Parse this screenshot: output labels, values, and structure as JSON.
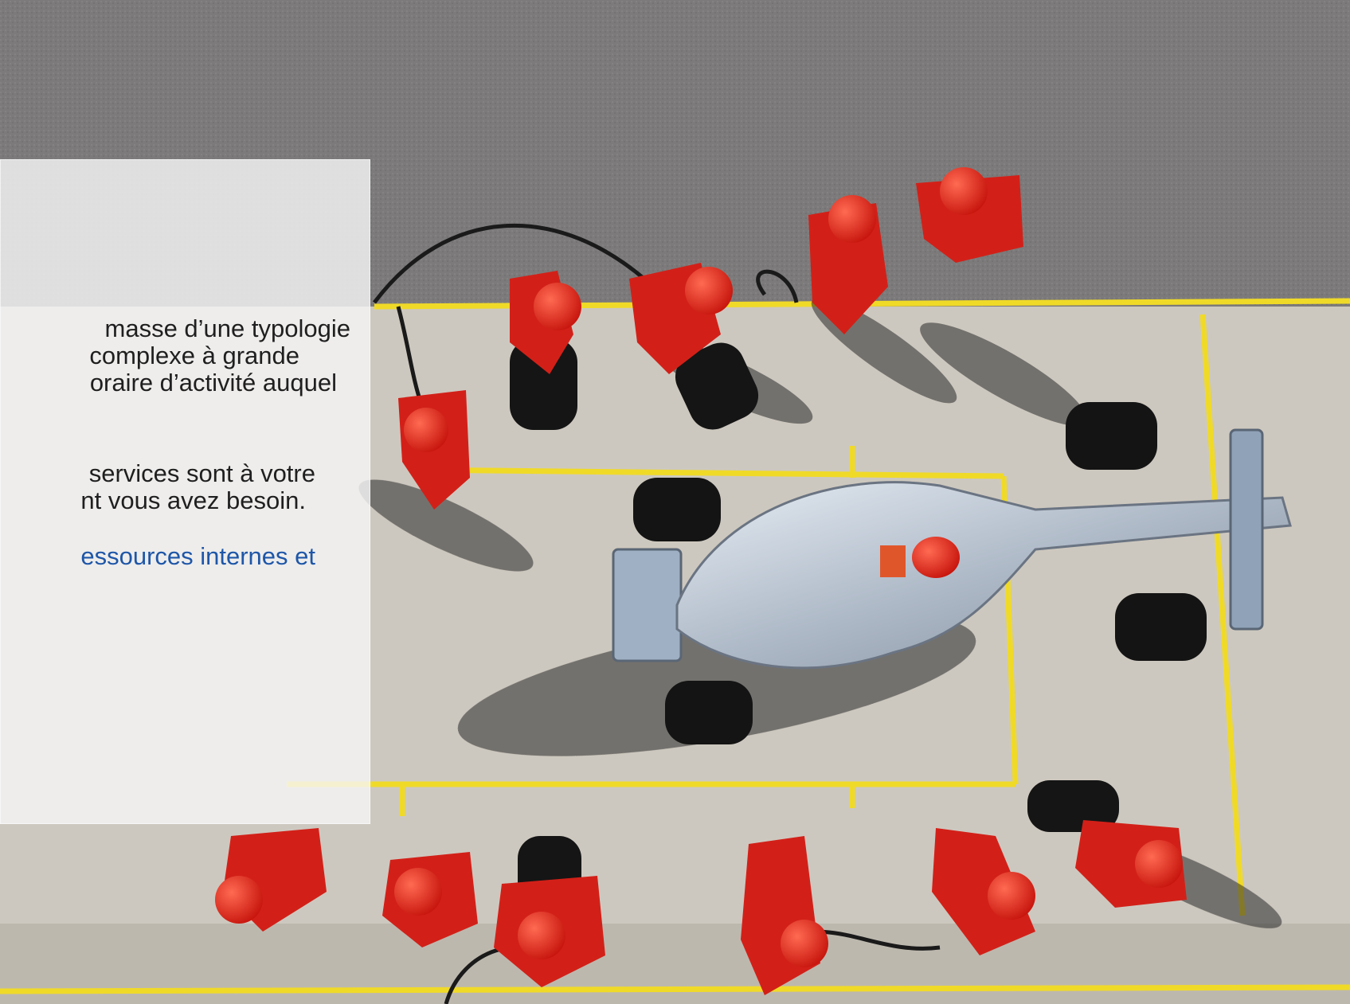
{
  "scene": {
    "description_icon": "race-car-pit-stop-photo"
  },
  "panel": {
    "lines_a": [
      "masse d’une typologie",
      "complexe à grande",
      "oraire d’activité auquel"
    ],
    "lines_b": [
      "services sont à votre",
      "nt vous avez besoin."
    ],
    "link_text": "essources internes et"
  },
  "colors": {
    "asphalt": "#7a7878",
    "pit_lane": "#cfcac1",
    "marking_yellow": "#f2dc2c",
    "crew_red": "#d8201a",
    "car_silver": "#b7c3d1",
    "link_blue": "#1e56a8"
  }
}
